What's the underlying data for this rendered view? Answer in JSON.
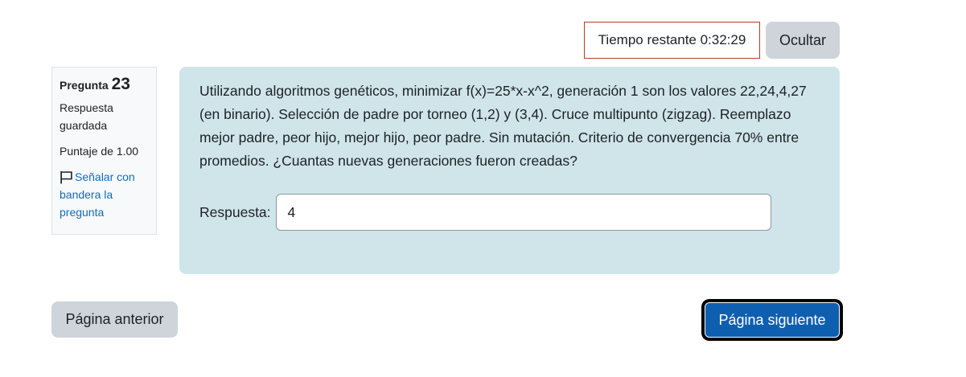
{
  "timer": {
    "label": "Tiempo restante 0:32:29"
  },
  "hide_button": {
    "label": "Ocultar"
  },
  "question_info": {
    "label": "Pregunta",
    "number": "23",
    "state": "Respuesta guardada",
    "grade": "Puntaje de 1.00",
    "flag_label": "Señalar con bandera la pregunta",
    "flag_icon": "flag-icon"
  },
  "question": {
    "text": "Utilizando algoritmos genéticos, minimizar f(x)=25*x-x^2, generación 1 son los valores 22,24,4,27 (en binario). Selección de padre por torneo (1,2) y (3,4). Cruce multipunto (zigzag). Reemplazo mejor padre, peor hijo, mejor hijo, peor padre. Sin mutación. Criterio de convergencia 70% entre promedios. ¿Cuantas nuevas generaciones fueron creadas?",
    "answer_label": "Respuesta:",
    "answer_value": "4"
  },
  "navigation": {
    "prev_label": "Página anterior",
    "next_label": "Página siguiente"
  },
  "colors": {
    "formulation_bg": "#cfe5ea",
    "timer_border": "#b83a2b",
    "primary": "#0f5fb0",
    "secondary": "#ced4da",
    "link": "#0f6cbf"
  }
}
